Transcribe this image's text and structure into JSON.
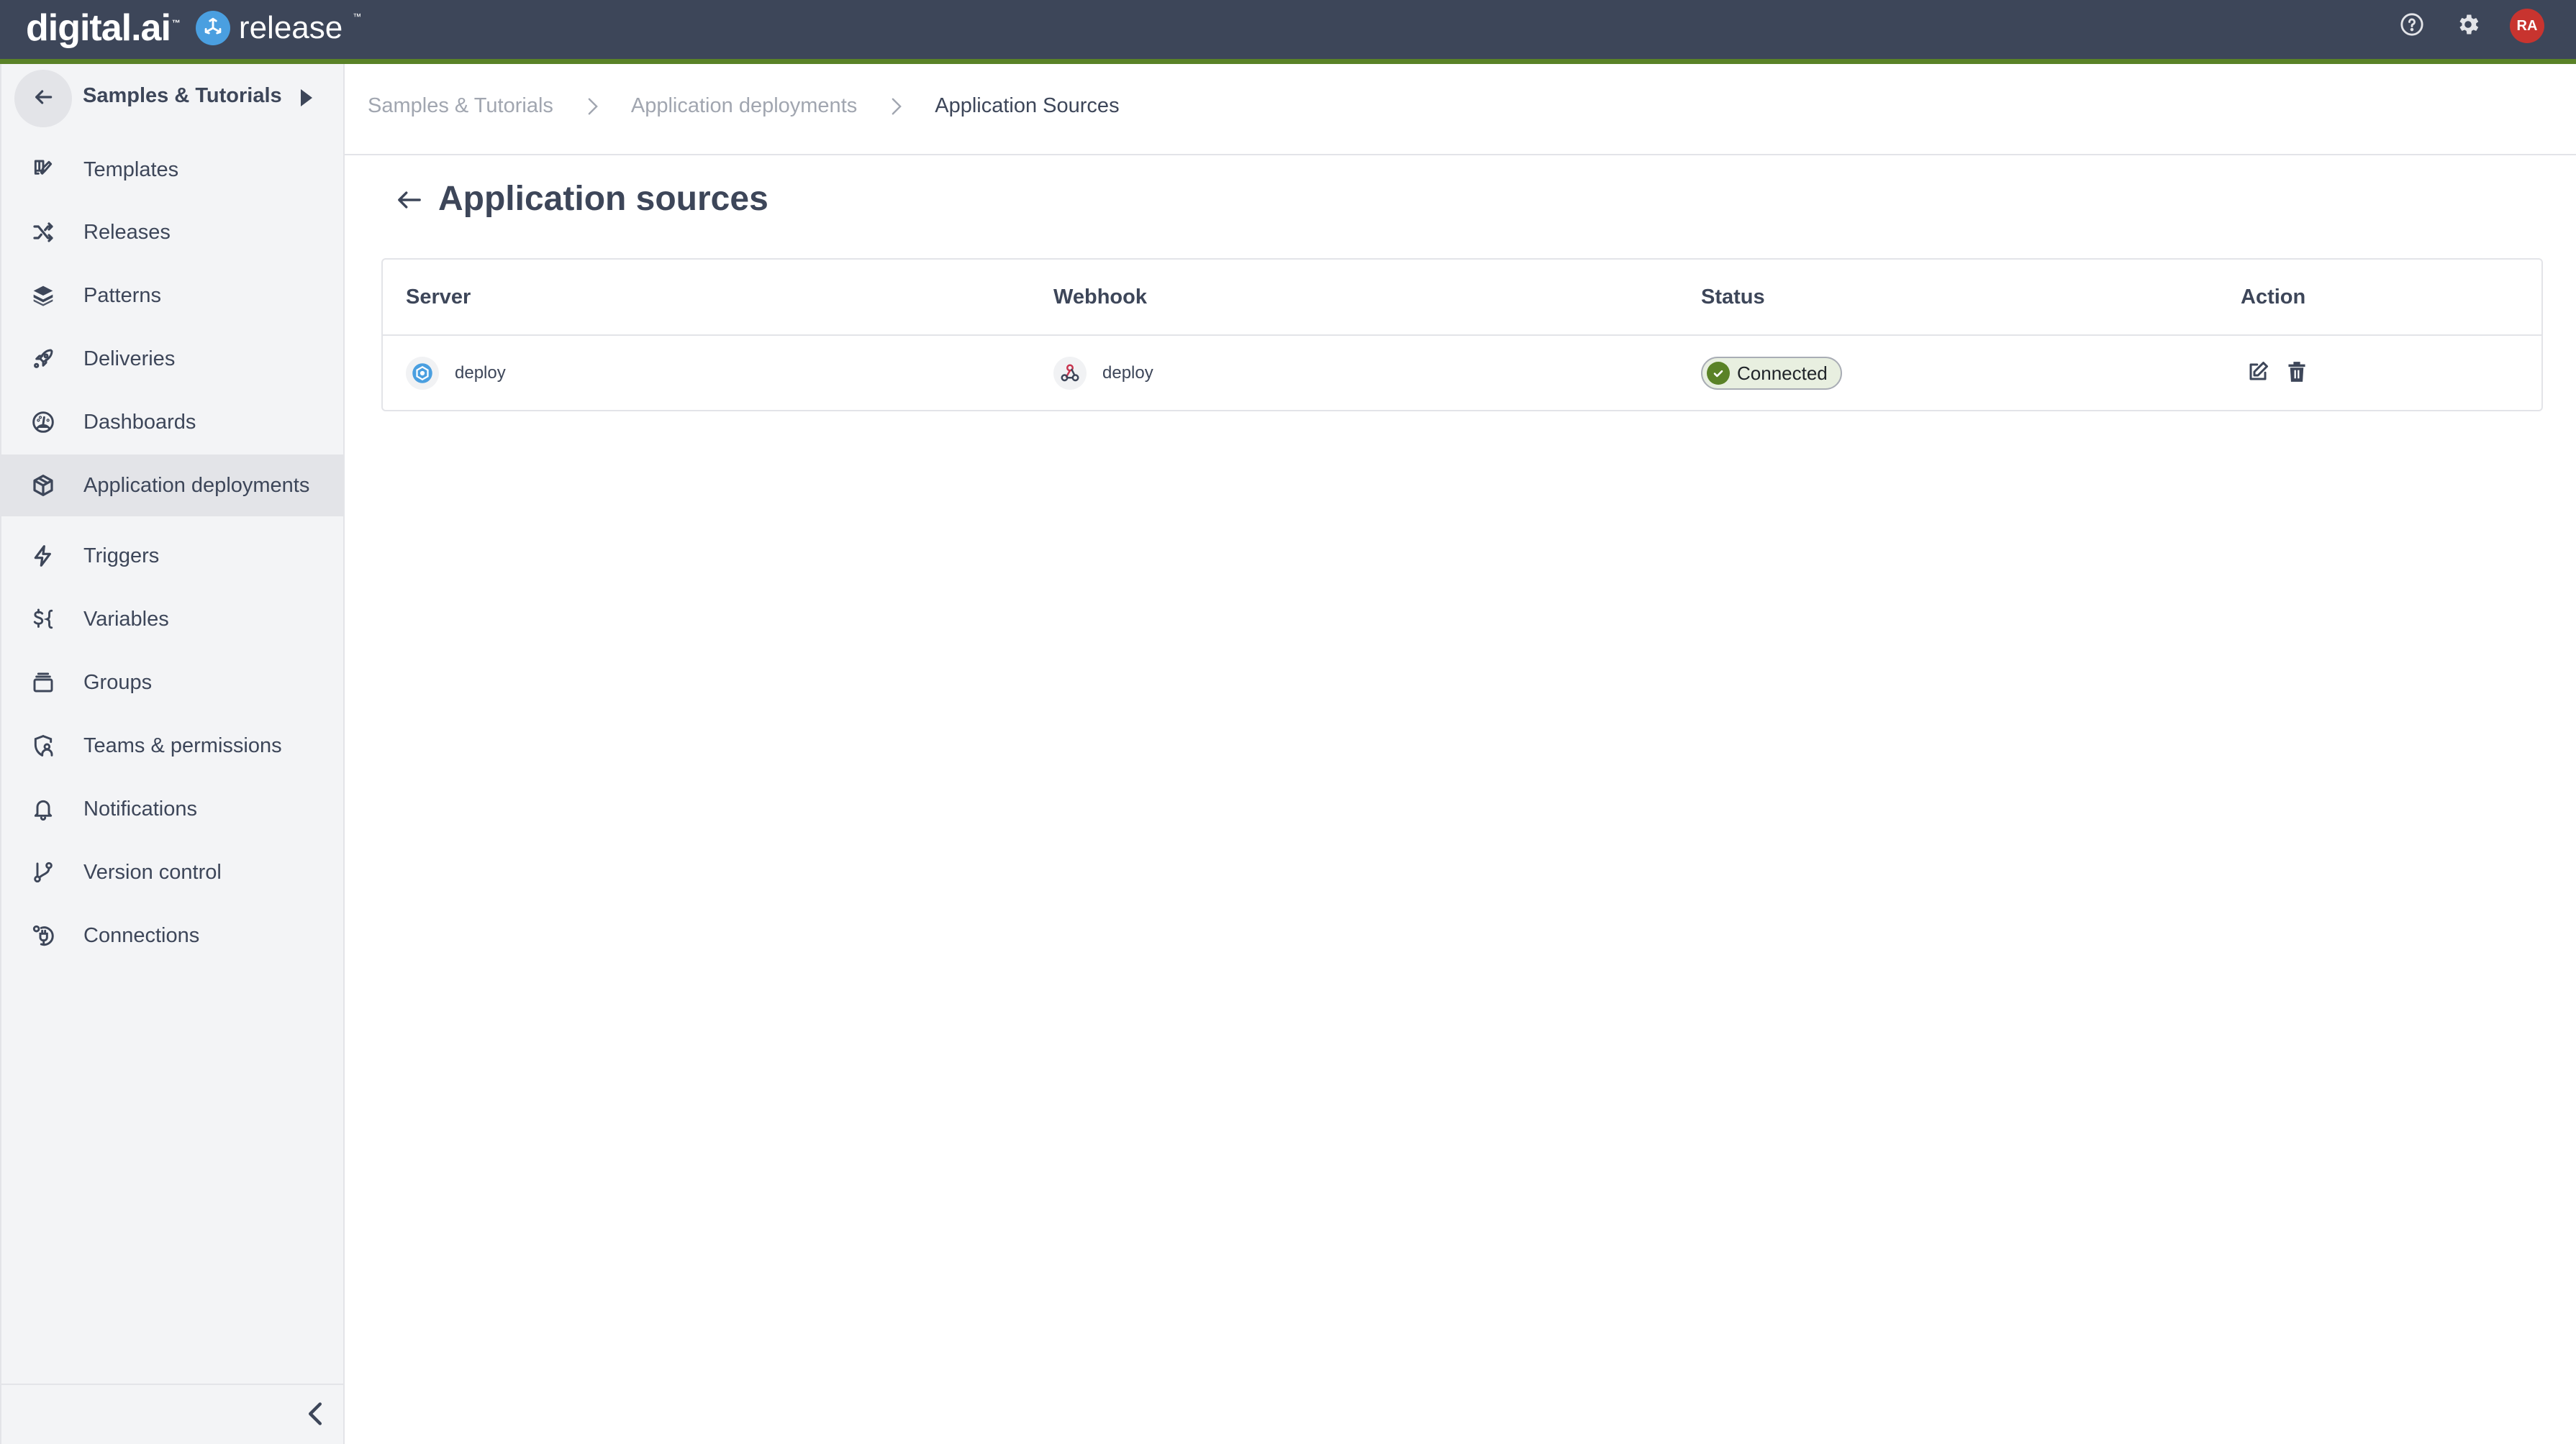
{
  "brand": {
    "company": "digital.ai",
    "product": "release",
    "trademark": "™"
  },
  "topbar": {
    "help_icon": "help-circle-icon",
    "settings_icon": "gear-icon",
    "avatar_initials": "RA",
    "avatar_color": "#c8342f"
  },
  "sidebar": {
    "folder_name": "Samples & Tutorials",
    "back_icon": "arrow-left-icon",
    "expand_icon": "caret-right-icon",
    "collapse_icon": "chevron-left-icon",
    "items": [
      {
        "label": "Templates",
        "icon": "templates-icon",
        "active": false
      },
      {
        "label": "Releases",
        "icon": "shuffle-icon",
        "active": false
      },
      {
        "label": "Patterns",
        "icon": "layers-icon",
        "active": false
      },
      {
        "label": "Deliveries",
        "icon": "rocket-icon",
        "active": false
      },
      {
        "label": "Dashboards",
        "icon": "gauge-icon",
        "active": false
      },
      {
        "label": "Application deployments",
        "icon": "package-icon",
        "active": true
      },
      {
        "label": "Triggers",
        "icon": "lightning-icon",
        "active": false
      },
      {
        "label": "Variables",
        "icon": "variables-icon",
        "active": false
      },
      {
        "label": "Groups",
        "icon": "groups-icon",
        "active": false
      },
      {
        "label": "Teams & permissions",
        "icon": "shield-user-icon",
        "active": false
      },
      {
        "label": "Notifications",
        "icon": "bell-icon",
        "active": false
      },
      {
        "label": "Version control",
        "icon": "git-branch-icon",
        "active": false
      },
      {
        "label": "Connections",
        "icon": "plug-icon",
        "active": false
      }
    ]
  },
  "breadcrumbs": [
    {
      "label": "Samples & Tutorials"
    },
    {
      "label": "Application deployments"
    },
    {
      "label": "Application Sources"
    }
  ],
  "page": {
    "title": "Application sources"
  },
  "table": {
    "columns": [
      "Server",
      "Webhook",
      "Status",
      "Action"
    ],
    "rows": [
      {
        "server": "deploy",
        "server_icon": "deploy-server-icon",
        "webhook": "deploy",
        "webhook_icon": "webhook-icon",
        "status": "Connected",
        "status_color": "#5a8227",
        "actions": [
          "edit-icon",
          "delete-icon"
        ]
      }
    ]
  },
  "colors": {
    "topbar": "#3d4659",
    "accent_green": "#5a8227",
    "sidebar_bg": "#f3f4f6",
    "text": "#3d4659",
    "muted_text": "#a1a6b0"
  }
}
